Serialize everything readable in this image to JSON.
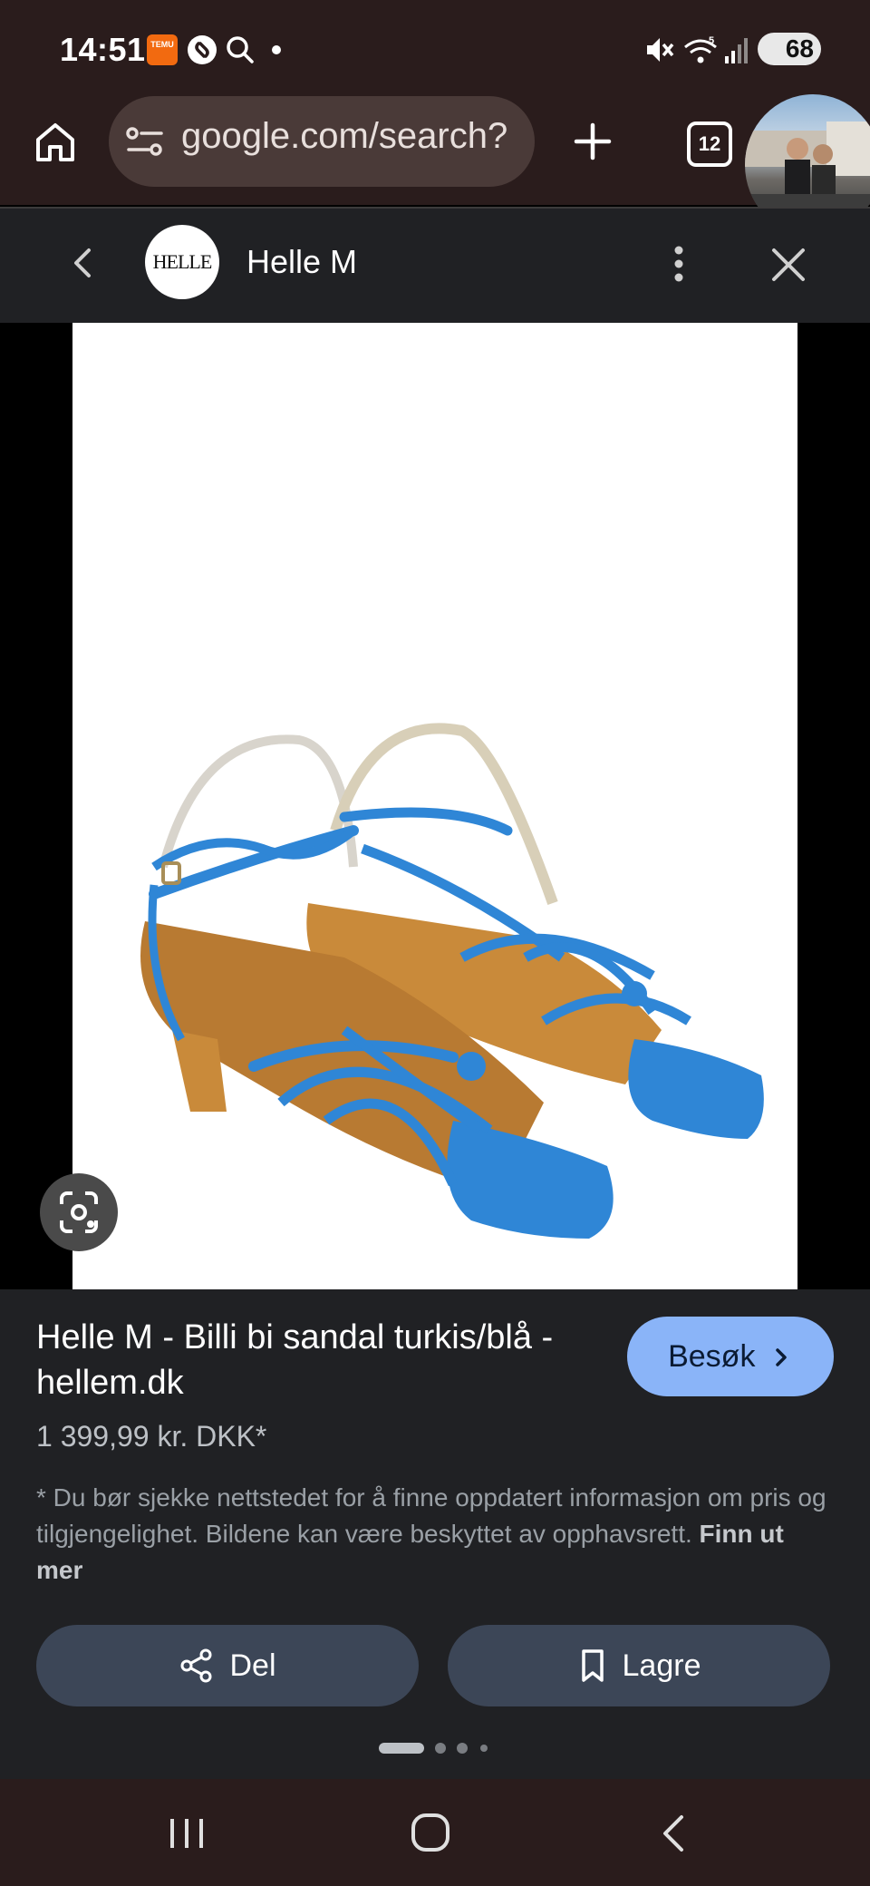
{
  "status_bar": {
    "time": "14:51",
    "battery": "68",
    "temu_label": "TEMU",
    "icons": [
      "temu-icon",
      "shazam-icon",
      "search-icon",
      "dot-icon",
      "mute-icon",
      "wifi-icon",
      "signal-icon",
      "battery-icon"
    ]
  },
  "browser": {
    "url": "google.com/search?",
    "tab_count": "12"
  },
  "panel": {
    "site_name": "Helle M",
    "logo_text": "HELLE M"
  },
  "product": {
    "title": "Helle M - Billi bi sandal turkis/blå - hellem.dk",
    "price": "1 399,99 kr. DKK*",
    "visit_label": "Besøk",
    "disclaimer": "* Du bør sjekke nettstedet for å finne oppdatert informasjon om pris og tilgjengelighet. Bildene kan være beskyttet av opphavsrett.",
    "learn_more": "Finn ut mer"
  },
  "actions": {
    "share_label": "Del",
    "save_label": "Lagre"
  },
  "colors": {
    "accent": "#8ab4f8",
    "sandal_blue": "#2f86d6",
    "panel_bg": "#202124"
  }
}
